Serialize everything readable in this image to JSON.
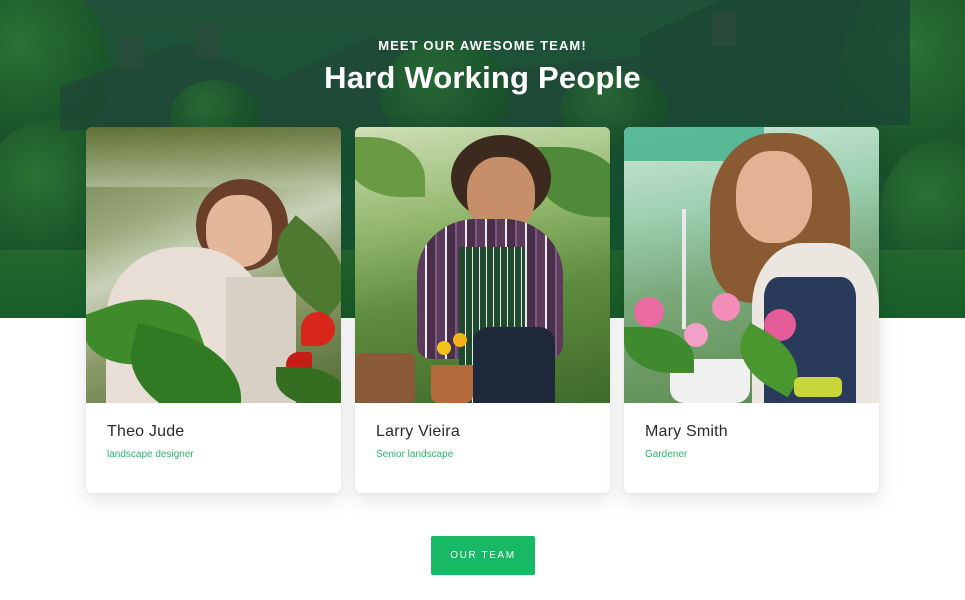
{
  "header": {
    "eyebrow": "MEET OUR AWESOME TEAM!",
    "title": "Hard Working People"
  },
  "team": [
    {
      "name": "Theo Jude",
      "role": "landscape designer"
    },
    {
      "name": "Larry Vieira",
      "role": "Senior landscape"
    },
    {
      "name": "Mary Smith",
      "role": "Gardener"
    }
  ],
  "cta": {
    "label": "OUR TEAM"
  },
  "colors": {
    "accent": "#17b964",
    "role_text": "#2fb36a",
    "hero_overlay": "#1f5a3a",
    "name_text": "#2b2b2b"
  }
}
